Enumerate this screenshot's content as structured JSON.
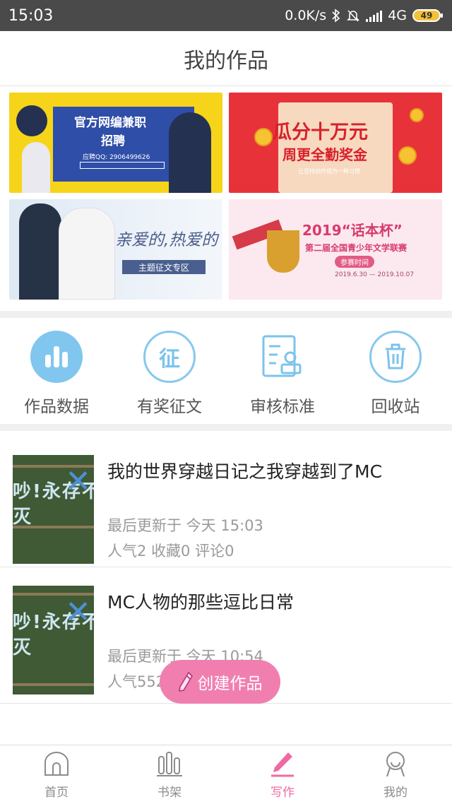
{
  "status_bar": {
    "time": "15:03",
    "net_speed": "0.0K/s",
    "network": "4G",
    "battery": "49"
  },
  "header": {
    "title": "我的作品"
  },
  "banners": [
    {
      "title": "官方网编兼职",
      "subtitle": "招聘",
      "contact": "应聘QQ: 2906499626"
    },
    {
      "title": "瓜分十万元",
      "subtitle": "周更全勤奖金",
      "note": "让坚持创作成为一种习惯"
    },
    {
      "title": "亲爱的,热爱的",
      "tag": "主题征文专区"
    },
    {
      "title": "2019“话本杯”",
      "subtitle": "第二届全国青少年文学联赛",
      "badge": "参赛时间",
      "dates": "2019.6.30 — 2019.10.07"
    }
  ],
  "actions": [
    {
      "label": "作品数据",
      "icon": "bar-chart-icon"
    },
    {
      "label": "有奖征文",
      "icon": "contest-icon",
      "glyph": "征"
    },
    {
      "label": "审核标准",
      "icon": "review-document-icon"
    },
    {
      "label": "回收站",
      "icon": "trash-icon"
    }
  ],
  "works": [
    {
      "title": "我的世界穿越日记之我穿越到了MC",
      "updated": "最后更新于 今天 15:03",
      "stats": "人气2 收藏0 评论0",
      "cover_text": "吵!永存不灭"
    },
    {
      "title": "MC人物的那些逗比日常",
      "updated": "最后更新于 今天 10:54",
      "stats": "人气552 收藏 评论",
      "cover_text": "吵!永存不灭"
    }
  ],
  "fab": {
    "label": "创建作品",
    "icon": "pencil-icon"
  },
  "tabbar": {
    "tabs": [
      {
        "label": "首页",
        "icon": "home-icon",
        "active": false
      },
      {
        "label": "书架",
        "icon": "bookshelf-icon",
        "active": false
      },
      {
        "label": "写作",
        "icon": "write-icon",
        "active": true
      },
      {
        "label": "我的",
        "icon": "profile-icon",
        "active": false
      }
    ]
  },
  "colors": {
    "accent": "#ef6aa4",
    "action_icon": "#80c6ef",
    "status_bar": "#4a4a4a"
  }
}
